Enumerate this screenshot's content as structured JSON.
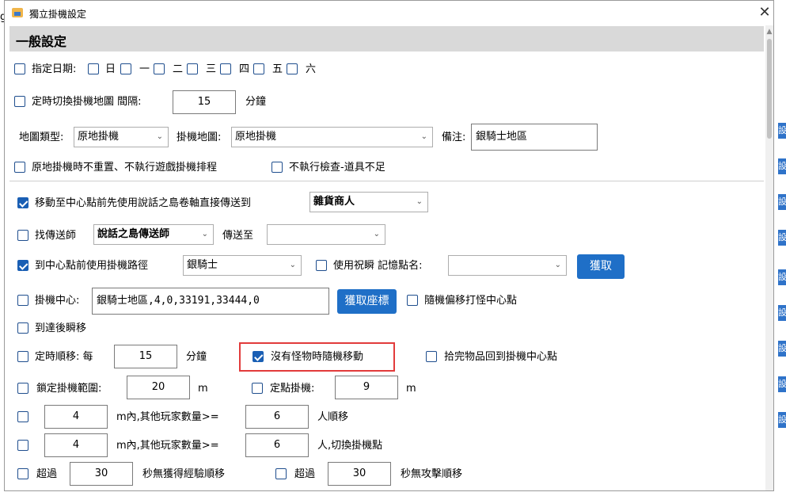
{
  "window": {
    "title": "獨立掛機設定",
    "close_glyph": "✕"
  },
  "background": {
    "left_char": "g",
    "right_chars": [
      "設",
      "設",
      "設",
      "設",
      "設",
      "設",
      "設",
      "設",
      "設"
    ]
  },
  "section": {
    "title": "一般設定"
  },
  "days": {
    "label": "指定日期:",
    "items": [
      "日",
      "一",
      "二",
      "三",
      "四",
      "五",
      "六"
    ]
  },
  "map_switch": {
    "label": "定時切換掛機地圖 間隔:",
    "value": "15",
    "unit": "分鐘"
  },
  "map_row": {
    "type_label": "地圖類型:",
    "type_value": "原地掛機",
    "map_label": "掛機地圖:",
    "map_value": "原地掛機",
    "note_label": "備注:",
    "note_value": "銀騎士地區"
  },
  "opts1": {
    "no_reset_label": "原地掛機時不重置、不執行遊戲掛機排程",
    "no_check_label": "不執行檢查-道具不足"
  },
  "move_center": {
    "label": "移動至中心點前先使用說話之島卷軸直接傳送到",
    "target": "雜貨商人",
    "checked": true
  },
  "teleporter": {
    "label": "找傳送師",
    "npc": "說話之島傳送師",
    "to_label": "傳送至",
    "to_value": ""
  },
  "path": {
    "label": "到中心點前使用掛機路徑",
    "value": "銀騎士",
    "checked": true,
    "bless_label": "使用祝瞬 記憶點名:",
    "bless_value": "",
    "get_button": "獲取"
  },
  "center": {
    "label": "掛機中心:",
    "value": "銀騎士地區,4,0,33191,33444,0",
    "get_button": "獲取座標",
    "random_label": "隨機偏移打怪中心點"
  },
  "teleport_after": {
    "label": "到達後瞬移"
  },
  "timed_move": {
    "label": "定時順移: 每",
    "value": "15",
    "unit": "分鐘",
    "no_monster_label": "沒有怪物時隨機移動",
    "no_monster_checked": true,
    "return_label": "拾完物品回到掛機中心點"
  },
  "lock_range": {
    "label": "鎖定掛機範圍:",
    "value": "20",
    "unit": "m",
    "fixed_label": "定點掛機:",
    "fixed_value": "9",
    "fixed_unit": "m"
  },
  "players1": {
    "distance": "4",
    "mid_label": "m內,其他玩家數量>=",
    "count": "6",
    "end_label": "人順移"
  },
  "players2": {
    "distance": "4",
    "mid_label": "m內,其他玩家數量>=",
    "count": "6",
    "end_label": "人,切換掛機點"
  },
  "exceed": {
    "label1": "超過",
    "value1": "30",
    "text1": "秒無獲得經驗順移",
    "label2": "超過",
    "value2": "30",
    "text2": "秒無攻擊順移"
  }
}
